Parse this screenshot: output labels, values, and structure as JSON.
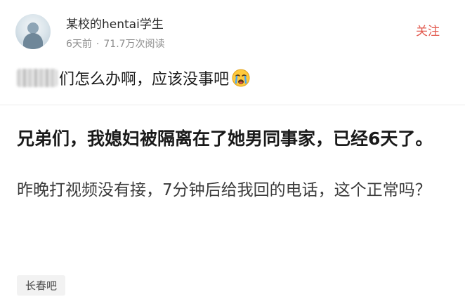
{
  "author": {
    "name": "某校的hentai学生",
    "time_ago": "6天前",
    "separator": "·",
    "views": "71.7万次阅读"
  },
  "follow_label": "关注",
  "title": {
    "text": "们怎么办啊，应该没事吧",
    "emoji": "crying-face"
  },
  "post": {
    "heading": "兄弟们，我媳妇被隔离在了她男同事家，已经6天了。",
    "body": "昨晚打视频没有接，7分钟后给我回的电话，这个正常吗？"
  },
  "tag": "长春吧",
  "colors": {
    "accent": "#e25a4f",
    "meta_gray": "#8d8d8d",
    "tag_bg": "#f2f2f2"
  }
}
